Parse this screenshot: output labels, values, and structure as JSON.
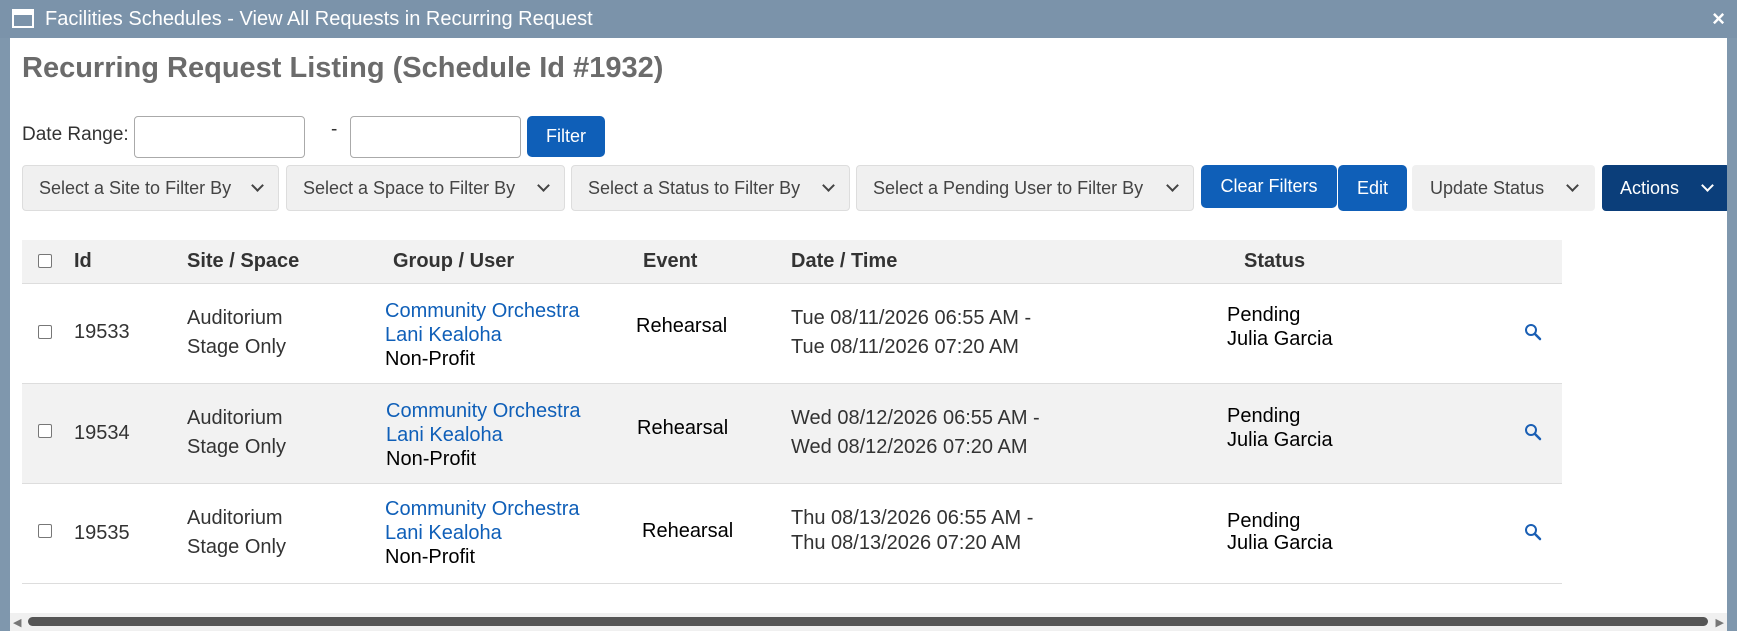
{
  "window": {
    "title": "Facilities Schedules - View All Requests in Recurring Request",
    "close_label": "×"
  },
  "page": {
    "title": "Recurring Request Listing (Schedule Id #1932)"
  },
  "filters": {
    "date_range_label": "Date Range:",
    "dash": "-",
    "date_from_value": "",
    "date_to_value": "",
    "filter_button": "Filter",
    "site_select": "Select a Site to Filter By",
    "space_select": "Select a Space to Filter By",
    "status_select": "Select a Status to Filter By",
    "pending_user_select": "Select a Pending User to Filter By",
    "clear_filters_button": "Clear Filters",
    "edit_button": "Edit",
    "update_status_button": "Update Status",
    "actions_button": "Actions"
  },
  "table": {
    "headers": [
      "Id",
      "Site / Space",
      "Group / User",
      "Event",
      "Date / Time",
      "Status"
    ],
    "rows": [
      {
        "id": "19533",
        "site": "Auditorium",
        "space": "Stage Only",
        "group": "Community Orchestra",
        "user": "Lani Kealoha",
        "org_type": "Non-Profit",
        "event": "Rehearsal",
        "start": "Tue 08/11/2026 06:55 AM -",
        "end": "Tue 08/11/2026 07:20 AM",
        "status": "Pending",
        "pending_user": "Julia Garcia"
      },
      {
        "id": "19534",
        "site": "Auditorium",
        "space": "Stage Only",
        "group": "Community Orchestra",
        "user": "Lani Kealoha",
        "org_type": "Non-Profit",
        "event": "Rehearsal",
        "start": "Wed 08/12/2026 06:55 AM -",
        "end": "Wed 08/12/2026 07:20 AM",
        "status": "Pending",
        "pending_user": "Julia Garcia"
      },
      {
        "id": "19535",
        "site": "Auditorium",
        "space": "Stage Only",
        "group": "Community Orchestra",
        "user": "Lani Kealoha",
        "org_type": "Non-Profit",
        "event": "Rehearsal",
        "start": "Thu 08/13/2026 06:55 AM -",
        "end": "Thu 08/13/2026 07:20 AM",
        "status": "Pending",
        "pending_user": "Julia Garcia"
      }
    ]
  },
  "colors": {
    "accent": "#0f5fb8",
    "actions": "#0b3e7a",
    "titlebar": "#7b93aa"
  },
  "icons": {
    "row_view": "magnifier-icon",
    "window": "window-icon",
    "close": "close-icon"
  }
}
